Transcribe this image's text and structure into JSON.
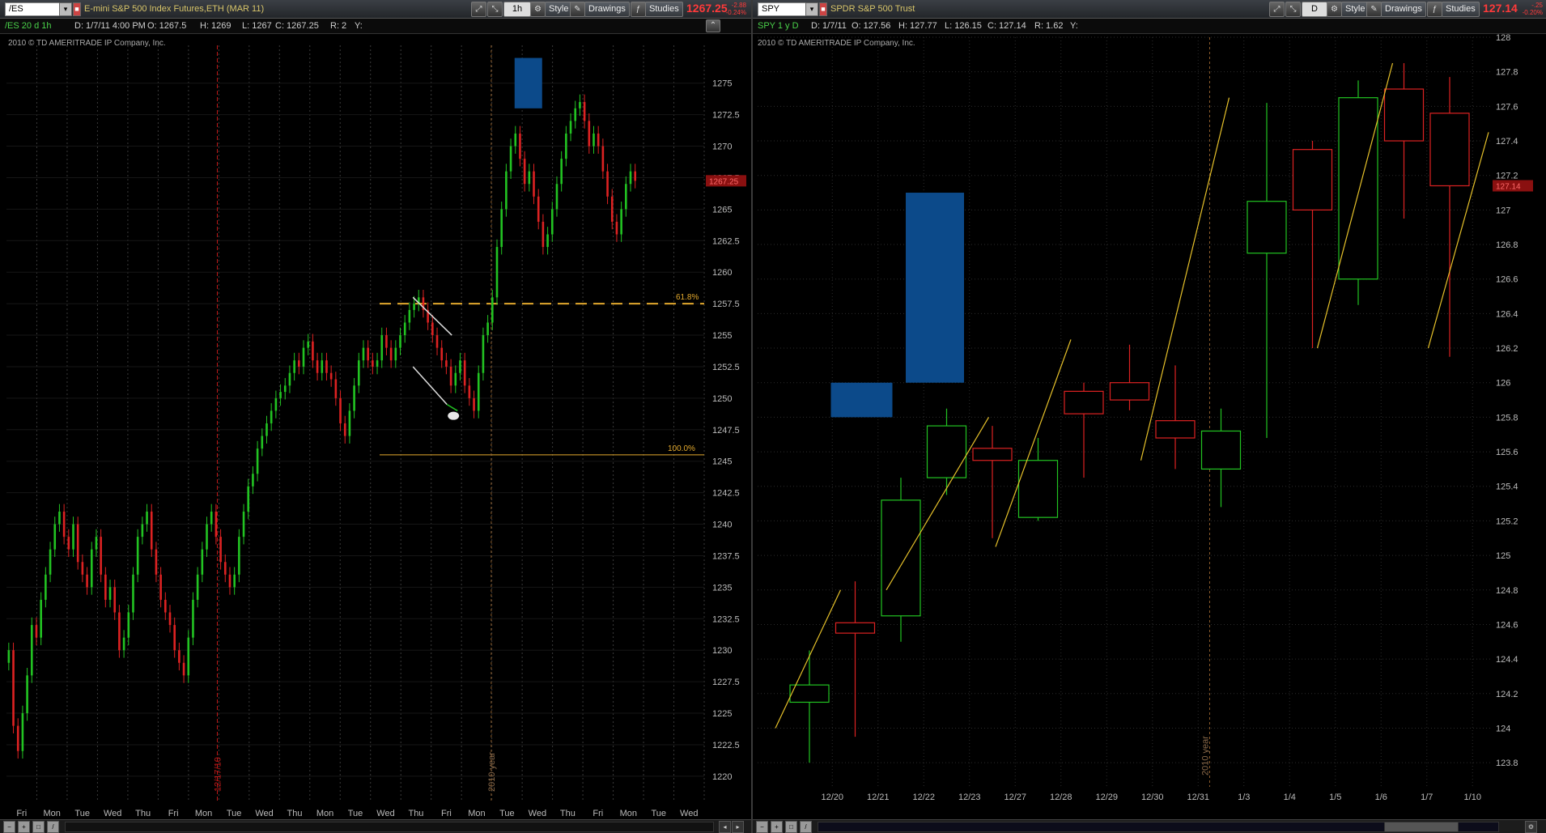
{
  "left": {
    "symbol": "/ES",
    "description": "E-mini S&P 500 Index Futures,ETH (MAR 11)",
    "aggregation": "1h",
    "style_label": "Style",
    "drawings_label": "Drawings",
    "studies_label": "Studies",
    "last_price": "1267.25",
    "change": "-2.88",
    "change_pct": "-0.24%",
    "info": {
      "title": "/ES 20 d 1h",
      "date": "D: 1/7/11 4:00 PM",
      "open": "O: 1267.5",
      "high": "H: 1269",
      "low": "L: 1267",
      "close": "C: 1267.25",
      "range": "R: 2",
      "y": "Y:"
    },
    "copyright": "2010 © TD AMERITRADE IP Company, Inc.",
    "price_marker": "1267.25",
    "fib_labels": [
      "61.8%",
      "100.0%"
    ],
    "vertical_labels": [
      "12/17/10",
      "2010 year"
    ],
    "chart_data": {
      "type": "candlestick",
      "y_ticks": [
        "1275",
        "1272.5",
        "1270",
        "1267.5",
        "1265",
        "1262.5",
        "1260",
        "1257.5",
        "1255",
        "1252.5",
        "1250",
        "1247.5",
        "1245",
        "1242.5",
        "1240",
        "1237.5",
        "1235",
        "1232.5",
        "1230",
        "1227.5",
        "1225",
        "1222.5",
        "1220"
      ],
      "ylim": [
        1218,
        1278
      ],
      "x_ticks": [
        "Fri",
        "Mon",
        "Tue",
        "Wed",
        "Thu",
        "Fri",
        "Mon",
        "Tue",
        "Wed",
        "Thu",
        "Mon",
        "Tue",
        "Wed",
        "Thu",
        "Fri",
        "Mon",
        "Tue",
        "Wed",
        "Thu",
        "Fri",
        "Mon",
        "Tue",
        "Wed"
      ],
      "closes": [
        1230,
        1224,
        1222,
        1225,
        1228,
        1232,
        1231,
        1234,
        1236,
        1238,
        1240,
        1241,
        1239,
        1238,
        1240,
        1237,
        1236,
        1235,
        1238,
        1239,
        1236,
        1234,
        1235,
        1233,
        1230,
        1231,
        1233,
        1236,
        1239,
        1240,
        1241,
        1238,
        1236,
        1234,
        1233,
        1232,
        1230,
        1229,
        1228,
        1231,
        1234,
        1236,
        1238,
        1240,
        1241,
        1239,
        1237,
        1236,
        1235,
        1236,
        1239,
        1241,
        1243,
        1244,
        1246,
        1247,
        1248,
        1249,
        1250,
        1250.5,
        1251,
        1252,
        1253,
        1252.5,
        1254,
        1254.5,
        1253,
        1252,
        1253,
        1252,
        1251.5,
        1250,
        1248,
        1247,
        1249,
        1251,
        1253,
        1254,
        1253,
        1252.5,
        1253,
        1255,
        1254,
        1253,
        1254,
        1255,
        1256,
        1257,
        1257.5,
        1258,
        1257,
        1256,
        1255,
        1254,
        1253,
        1252.5,
        1251,
        1252,
        1253,
        1251,
        1250,
        1249,
        1252,
        1255,
        1256,
        1258,
        1262,
        1265,
        1268,
        1270,
        1271,
        1269,
        1267,
        1268,
        1266,
        1264,
        1262,
        1263,
        1265,
        1267,
        1269,
        1271,
        1272,
        1273,
        1273.5,
        1272,
        1270,
        1271,
        1270,
        1268,
        1266,
        1264,
        1263,
        1265,
        1267,
        1268,
        1267.25
      ]
    },
    "zones": [
      {
        "label": "blue-zone",
        "y_top": 1277,
        "y_bottom": 1273
      }
    ]
  },
  "right": {
    "symbol": "SPY",
    "description": "SPDR S&P 500 Trust",
    "aggregation": "D",
    "style_label": "Style",
    "drawings_label": "Drawings",
    "studies_label": "Studies",
    "last_price": "127.14",
    "change": "-.25",
    "change_pct": "-0.20%",
    "info": {
      "title": "SPY 1 y D",
      "date": "D: 1/7/11",
      "open": "O: 127.56",
      "high": "H: 127.77",
      "low": "L: 126.15",
      "close": "C: 127.14",
      "range": "R: 1.62",
      "y": "Y:"
    },
    "copyright": "2010 © TD AMERITRADE IP Company, Inc.",
    "price_marker": "127.14",
    "vertical_labels": [
      "2010 year"
    ],
    "chart_data": {
      "type": "candlestick",
      "y_ticks": [
        "128",
        "127.8",
        "127.6",
        "127.4",
        "127.2",
        "127",
        "126.8",
        "126.6",
        "126.4",
        "126.2",
        "126",
        "125.8",
        "125.6",
        "125.4",
        "125.2",
        "125",
        "124.8",
        "124.6",
        "124.4",
        "124.2",
        "124",
        "123.8"
      ],
      "ylim": [
        123.66,
        128.0
      ],
      "x_ticks": [
        "12/20",
        "12/21",
        "12/22",
        "12/23",
        "12/27",
        "12/28",
        "12/29",
        "12/30",
        "12/31",
        "1/3",
        "1/4",
        "1/5",
        "1/6",
        "1/7",
        "1/10"
      ],
      "candles": [
        {
          "o": 124.15,
          "h": 124.45,
          "l": 123.8,
          "c": 124.25
        },
        {
          "o": 124.61,
          "h": 124.85,
          "l": 123.95,
          "c": 124.55
        },
        {
          "o": 124.65,
          "h": 125.45,
          "l": 124.5,
          "c": 125.32
        },
        {
          "o": 125.45,
          "h": 125.85,
          "l": 125.35,
          "c": 125.75
        },
        {
          "o": 125.62,
          "h": 125.75,
          "l": 125.1,
          "c": 125.55
        },
        {
          "o": 125.22,
          "h": 125.68,
          "l": 125.2,
          "c": 125.55
        },
        {
          "o": 125.95,
          "h": 126.0,
          "l": 125.45,
          "c": 125.82
        },
        {
          "o": 126.0,
          "h": 126.22,
          "l": 125.84,
          "c": 125.9
        },
        {
          "o": 125.78,
          "h": 126.1,
          "l": 125.5,
          "c": 125.68
        },
        {
          "o": 125.5,
          "h": 125.85,
          "l": 125.28,
          "c": 125.72
        },
        {
          "o": 126.75,
          "h": 127.62,
          "l": 125.68,
          "c": 127.05
        },
        {
          "o": 127.35,
          "h": 127.4,
          "l": 126.2,
          "c": 127.0
        },
        {
          "o": 126.6,
          "h": 127.75,
          "l": 126.45,
          "c": 127.65
        },
        {
          "o": 127.7,
          "h": 127.85,
          "l": 126.95,
          "c": 127.4
        },
        {
          "o": 127.56,
          "h": 127.77,
          "l": 126.15,
          "c": 127.14
        }
      ]
    }
  },
  "colors": {
    "up": "#22c322",
    "down": "#dd2222",
    "grid": "#2c2c2c",
    "fib": "#e3a92d",
    "trend": "#e6c12a",
    "zone": "#0c4a8a"
  }
}
